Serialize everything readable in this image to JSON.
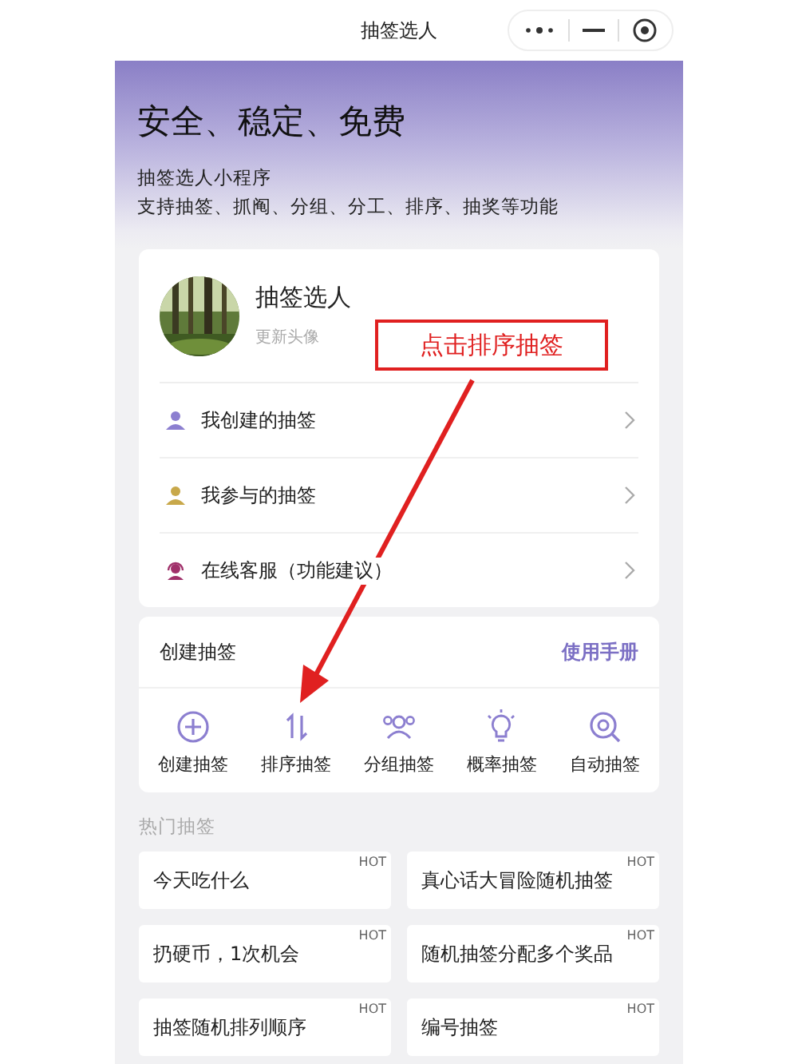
{
  "top_bar": {
    "title": "抽签选人"
  },
  "header": {
    "headline": "安全、稳定、免费",
    "subtitle": "抽签选人小程序",
    "description": "支持抽签、抓阄、分组、分工、排序、抽奖等功能"
  },
  "profile": {
    "name": "抽签选人",
    "action": "更新头像"
  },
  "menu": [
    {
      "label": "我创建的抽签"
    },
    {
      "label": "我参与的抽签"
    },
    {
      "label": "在线客服（功能建议）"
    }
  ],
  "create": {
    "title": "创建抽签",
    "link": "使用手册",
    "tools": [
      {
        "label": "创建抽签"
      },
      {
        "label": "排序抽签"
      },
      {
        "label": "分组抽签"
      },
      {
        "label": "概率抽签"
      },
      {
        "label": "自动抽签"
      }
    ]
  },
  "hot": {
    "title": "热门抽签",
    "items": [
      {
        "label": "今天吃什么",
        "badge": "HOT"
      },
      {
        "label": "真心话大冒险随机抽签",
        "badge": "HOT"
      },
      {
        "label": "扔硬币，1次机会",
        "badge": "HOT"
      },
      {
        "label": "随机抽签分配多个奖品",
        "badge": "HOT"
      },
      {
        "label": "抽签随机排列顺序",
        "badge": "HOT"
      },
      {
        "label": "编号抽签",
        "badge": "HOT"
      }
    ]
  },
  "annotation": {
    "label": "点击排序抽签"
  }
}
